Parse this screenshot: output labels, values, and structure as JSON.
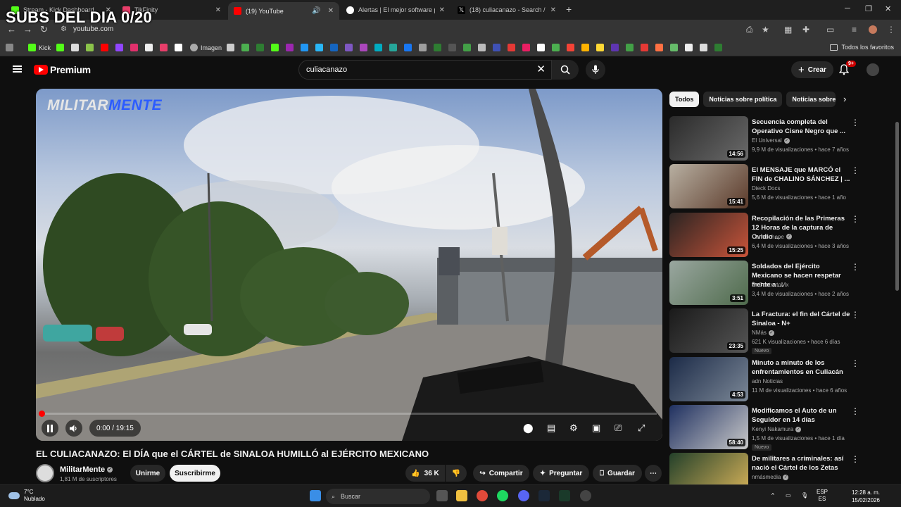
{
  "overlay": {
    "text": "SUBS DEL DIA 0/20"
  },
  "browser": {
    "tabs": [
      {
        "label": "Stream - Kick Dashboard",
        "color": "#53fc18"
      },
      {
        "label": "TikFinity",
        "color": "#e83e6a"
      },
      {
        "label": "(19) YouTube",
        "color": "#ff0000"
      },
      {
        "label": "Alertas | El mejor software para",
        "color": "#ffffff"
      },
      {
        "label": "(18) culiacanazo - Search / X",
        "color": "#ffffff"
      }
    ],
    "url": "youtube.com",
    "bookmarks": [
      "Kick",
      "Imagen"
    ],
    "bookmarks_folder": "Todos los favoritos"
  },
  "youtube": {
    "logo_text": "Premium",
    "search_value": "culiacanazo",
    "create_label": "Crear",
    "notif_badge": "9+",
    "player": {
      "watermark_a": "MILITAR",
      "watermark_b": "MENTE",
      "time": "0:00 / 19:15",
      "progress": 0.0
    },
    "video_title": "EL CULIACANAZO: El DÍA que el CÁRTEL de SINALOA HUMILLÓ al EJÉRCITO MEXICANO",
    "channel": {
      "name": "MilitarMente",
      "subs": "1,81 M de suscriptores"
    },
    "actions": {
      "join": "Unirme",
      "subscribe": "Suscribirme",
      "likes": "36 K",
      "share": "Compartir",
      "ask": "Preguntar",
      "save": "Guardar"
    },
    "chips": [
      "Todos",
      "Noticias sobre política",
      "Noticias sobre"
    ],
    "recommendations": [
      {
        "title": "Secuencia completa del Operativo Cisne Negro que ...",
        "channel": "El Universal",
        "verified": true,
        "meta": "9,9 M de visualizaciones • hace 7 años",
        "duration": "14:56",
        "nuevo": "",
        "c1": "#2b2b2b",
        "c2": "#6a6a6a"
      },
      {
        "title": "El MENSAJE que MARCÓ el FIN de CHALINO SÁNCHEZ | ...",
        "channel": "Dieck Docs",
        "verified": false,
        "meta": "5,6 M de visualizaciones • hace 1 año",
        "duration": "15:41",
        "nuevo": "",
        "c1": "#b8b0a2",
        "c2": "#5b3a2a"
      },
      {
        "title": "Recopilación de las Primeras 12 Horas de la captura de Ovidio ...",
        "channel": "Carmochepe",
        "verified": true,
        "meta": "6,4 M de visualizaciones • hace 3 años",
        "duration": "15:25",
        "nuevo": "",
        "c1": "#2a2422",
        "c2": "#c9543a"
      },
      {
        "title": "Soldados del Ejército Mexicano se hacen respetar frente a ...",
        "channel": "EnContextoMx",
        "verified": false,
        "meta": "3,4 M de visualizaciones • hace 2 años",
        "duration": "3:51",
        "nuevo": "",
        "c1": "#9aa7a0",
        "c2": "#4f6b4c"
      },
      {
        "title": "La Fractura: el fin del Cártel de Sinaloa - N+",
        "channel": "NMás",
        "verified": true,
        "meta": "621 K visualizaciones • hace 6 días",
        "duration": "23:35",
        "nuevo": "Nuevo",
        "c1": "#1a1a1a",
        "c2": "#555555"
      },
      {
        "title": "Minuto a minuto de los enfrentamientos en Culiacán",
        "channel": "adn Noticias",
        "verified": false,
        "meta": "11 M de visualizaciones • hace 6 años",
        "duration": "4:53",
        "nuevo": "",
        "c1": "#1c2b48",
        "c2": "#7b8796"
      },
      {
        "title": "Modificamos el Auto de un Seguidor en 14 días",
        "channel": "Kenyi Nakamura",
        "verified": true,
        "meta": "1,5 M de visualizaciones • hace 1 día",
        "duration": "58:40",
        "nuevo": "Nuevo",
        "c1": "#1f3060",
        "c2": "#c9c9c9"
      },
      {
        "title": "De militares a criminales: así nació el Cártel de los Zetas",
        "channel": "nmásmedia",
        "verified": true,
        "meta": "",
        "duration": "",
        "nuevo": "",
        "c1": "#23402a",
        "c2": "#d9b45a"
      }
    ]
  },
  "taskbar": {
    "temp": "7°C",
    "weather": "Nublado",
    "search": "Buscar",
    "lang": "ESP",
    "lang2": "ES",
    "time": "12:28 a. m.",
    "date": "15/02/2026"
  }
}
